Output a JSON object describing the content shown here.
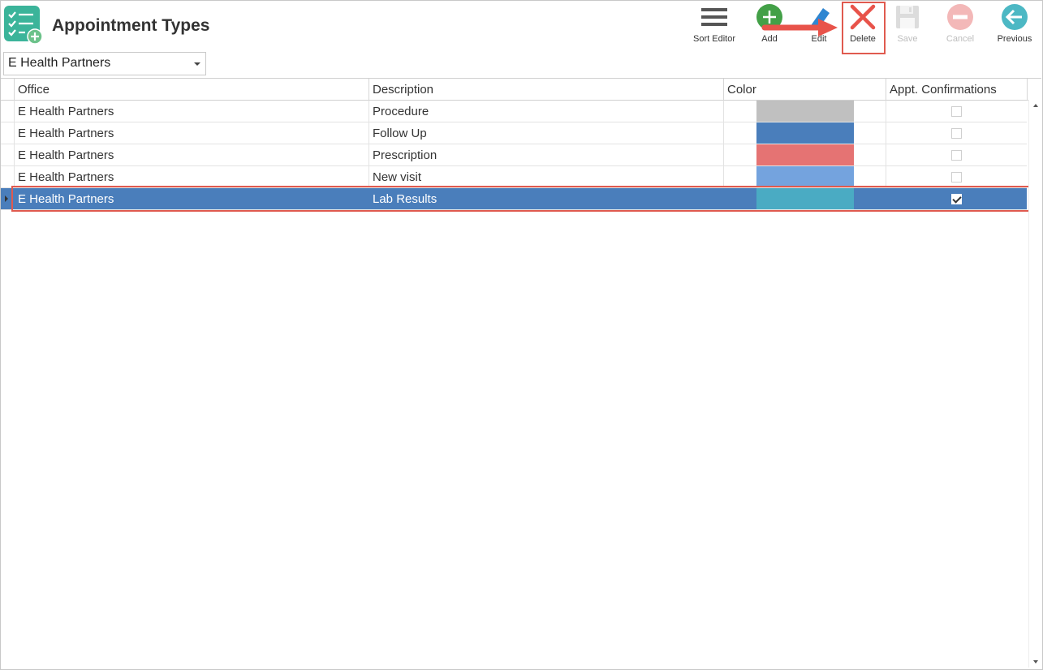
{
  "header": {
    "title": "Appointment Types",
    "icon": "checklist-add-icon"
  },
  "toolbar": {
    "sort_editor": "Sort Editor",
    "add": "Add",
    "edit": "Edit",
    "delete": "Delete",
    "save": "Save",
    "cancel": "Cancel",
    "previous": "Previous"
  },
  "office_select": {
    "value": "E Health Partners"
  },
  "grid": {
    "columns": [
      "Office",
      "Description",
      "Color",
      "Appt. Confirmations"
    ],
    "rows": [
      {
        "office": "E Health Partners",
        "description": "Procedure",
        "color": "#c0c0c0",
        "confirm": false
      },
      {
        "office": "E Health Partners",
        "description": "Follow Up",
        "color": "#4a7ebb",
        "confirm": false
      },
      {
        "office": "E Health Partners",
        "description": "Prescription",
        "color": "#e57373",
        "confirm": false
      },
      {
        "office": "E Health Partners",
        "description": "New visit",
        "color": "#74a3de",
        "confirm": false
      },
      {
        "office": "E Health Partners",
        "description": "Lab Results",
        "color": "#4aabc3",
        "confirm": true
      }
    ],
    "selected_row": 4
  },
  "colors": {
    "selection": "#4a7ebb",
    "highlight": "#e05a4f",
    "add_green": "#43a047",
    "delete_red": "#e8534a",
    "previous_teal": "#4cb8c4"
  }
}
